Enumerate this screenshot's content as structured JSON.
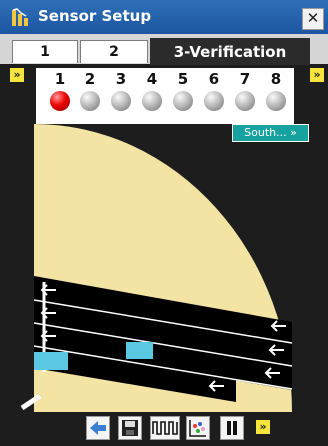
{
  "window": {
    "title": "Sensor Setup",
    "close_glyph": "✕"
  },
  "tabs": [
    {
      "label": "1",
      "active": false
    },
    {
      "label": "2",
      "active": false
    },
    {
      "label": "3-Verification",
      "active": true
    }
  ],
  "scroll_glyph": "»",
  "sensors": [
    {
      "number": "1",
      "state": "active",
      "color": "#e00000"
    },
    {
      "number": "2",
      "state": "inactive"
    },
    {
      "number": "3",
      "state": "inactive"
    },
    {
      "number": "4",
      "state": "inactive"
    },
    {
      "number": "5",
      "state": "inactive"
    },
    {
      "number": "6",
      "state": "inactive"
    },
    {
      "number": "7",
      "state": "inactive"
    },
    {
      "number": "8",
      "state": "inactive"
    }
  ],
  "direction_button": "South... »",
  "colors": {
    "field": "#f3e4a4",
    "lane": "#000000",
    "vehicle": "#5ac8e0",
    "title_bar": "#1c56a0",
    "direction_button": "#16a3a0",
    "toolbar_accent": "#f5e43c"
  },
  "toolbar": [
    "back-arrow-icon",
    "save-icon",
    "waveform-icon",
    "scatter-plot-icon",
    "pause-icon",
    "more-icon"
  ]
}
